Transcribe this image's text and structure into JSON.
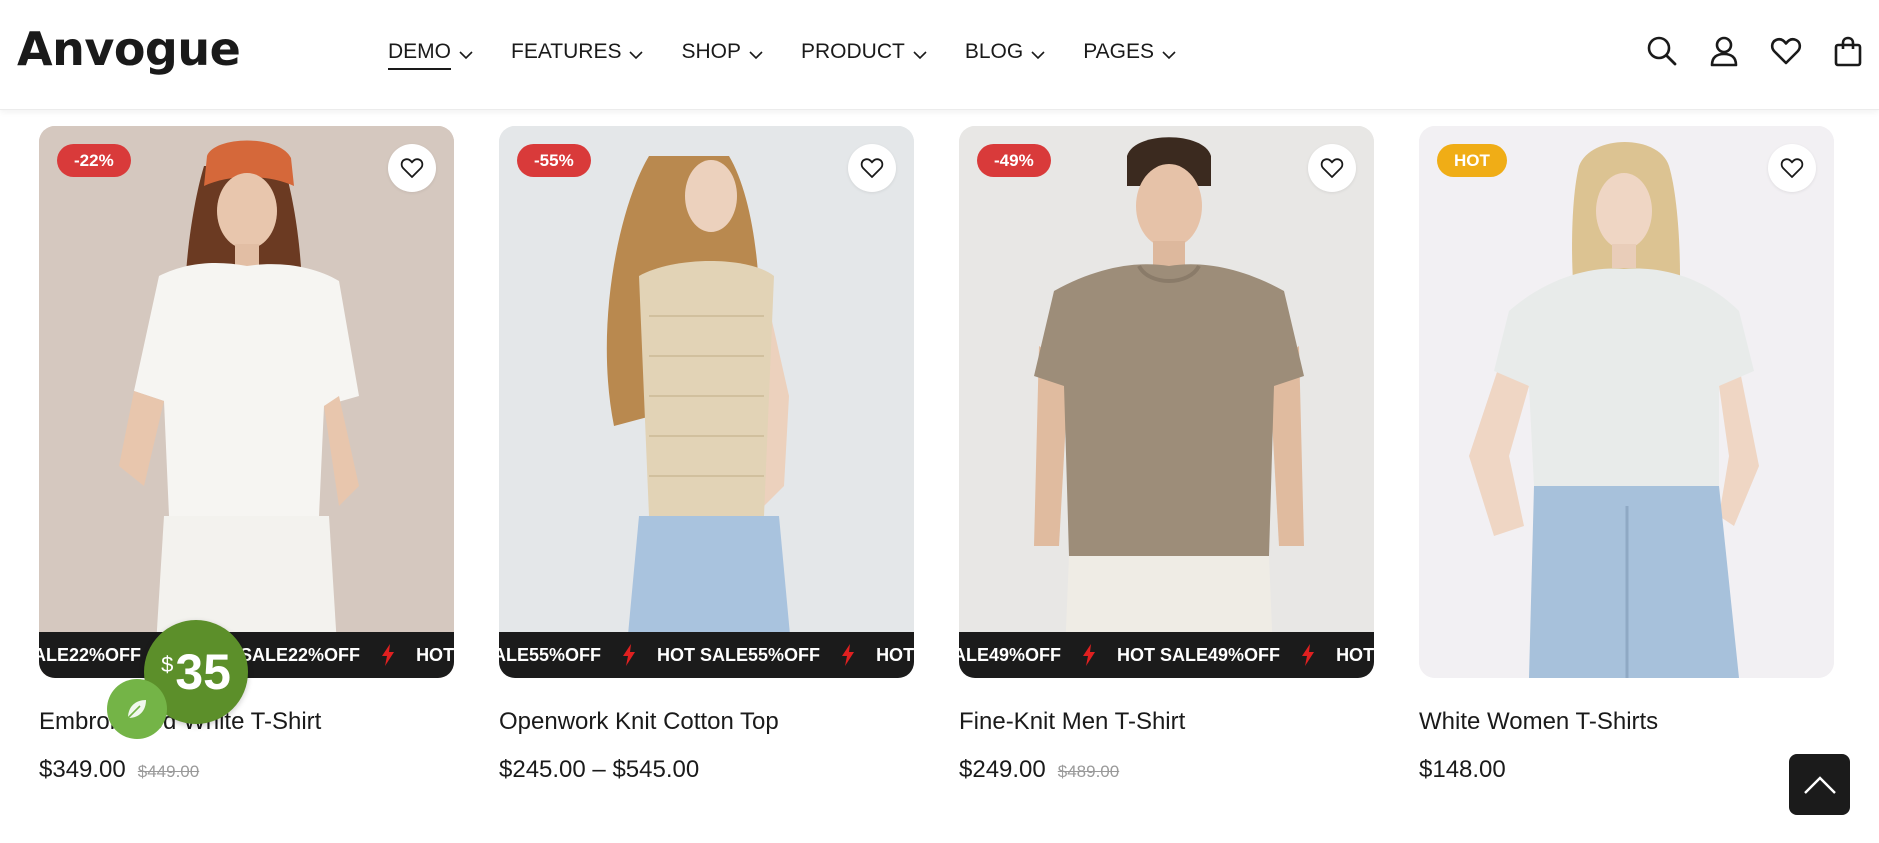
{
  "header": {
    "logo": "Anvogue",
    "nav": [
      {
        "label": "DEMO",
        "active": true
      },
      {
        "label": "FEATURES",
        "active": false
      },
      {
        "label": "SHOP",
        "active": false
      },
      {
        "label": "PRODUCT",
        "active": false
      },
      {
        "label": "BLOG",
        "active": false
      },
      {
        "label": "PAGES",
        "active": false
      }
    ],
    "icons": [
      "search-icon",
      "user-icon",
      "heart-icon",
      "shopping-bag-icon"
    ]
  },
  "products": [
    {
      "badge": "-22%",
      "badge_color": "#d93a3a",
      "image_bg": "#d8cbc3",
      "ticker": [
        "ALE22%OFF",
        "HOT SALE22%OFF",
        "HOT S"
      ],
      "title": "Embroidered White T-Shirt",
      "price": "$349.00",
      "old_price": "$449.00"
    },
    {
      "badge": "-55%",
      "badge_color": "#d93a3a",
      "image_bg": "#e3e6e8",
      "ticker": [
        "ALE55%OFF",
        "HOT SALE55%OFF",
        "HOT S"
      ],
      "title": "Openwork Knit Cotton Top",
      "price": "$245.00 – $545.00",
      "old_price": ""
    },
    {
      "badge": "-49%",
      "badge_color": "#d93a3a",
      "image_bg": "#e7e6e4",
      "ticker": [
        "ALE49%OFF",
        "HOT SALE49%OFF",
        "HOT S"
      ],
      "title": "Fine-Knit Men T-Shirt",
      "price": "$249.00",
      "old_price": "$489.00"
    },
    {
      "badge": "HOT",
      "badge_color": "#f0ad16",
      "image_bg": "#f2f0f3",
      "ticker": [],
      "title": "White Women T-Shirts",
      "price": "$148.00",
      "old_price": ""
    }
  ],
  "promo": {
    "currency": "$",
    "amount": "35"
  },
  "colors": {
    "ticker_bg": "#1b1b1b",
    "promo_green": "#5c8f2a",
    "leaf_green": "#74b447",
    "bolt": "#e02020"
  }
}
